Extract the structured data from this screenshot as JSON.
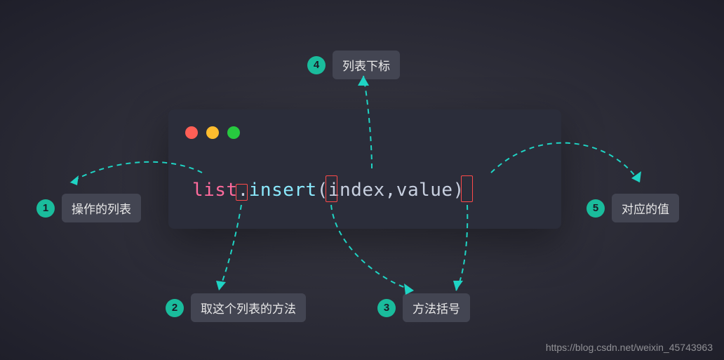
{
  "code": {
    "list": "list",
    "dot": ".",
    "method": "insert",
    "openParen": "(",
    "arg1": "index",
    "comma": ",",
    "arg2": "value",
    "closeParen": ")"
  },
  "annotations": {
    "a1": {
      "num": "1",
      "text": "操作的列表"
    },
    "a2": {
      "num": "2",
      "text": "取这个列表的方法"
    },
    "a3": {
      "num": "3",
      "text": "方法括号"
    },
    "a4": {
      "num": "4",
      "text": "列表下标"
    },
    "a5": {
      "num": "5",
      "text": "对应的值"
    }
  },
  "watermark": "https://blog.csdn.net/weixin_45743963"
}
